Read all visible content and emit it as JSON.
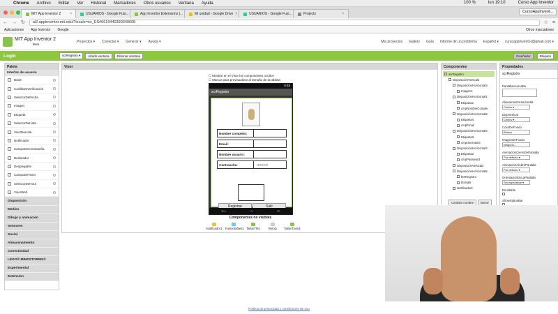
{
  "mac": {
    "apple": "",
    "app": "Chrome",
    "menus": [
      "Archivo",
      "Editar",
      "Ver",
      "Historial",
      "Marcadores",
      "Otros usuarios",
      "Ventana",
      "Ayuda"
    ],
    "battery": "100 %",
    "time": "lun 19:10",
    "user": "Curso App Inventor"
  },
  "tabs": [
    {
      "label": "MIT App Inventor 2"
    },
    {
      "label": "USUARIOS - Google Fusi..."
    },
    {
      "label": "App Inventor Extensions |..."
    },
    {
      "label": "Mi unidad - Google Drive"
    },
    {
      "label": "USUARIOS - Google Fusi..."
    },
    {
      "label": "Projects"
    }
  ],
  "profile": "CursoAppInvent...",
  "url": "ai2.appinventor.mit.edu/?locale=es_ES#6619440390340608",
  "bookmarks": [
    "Aplicaciones",
    "App Inventor",
    "Google"
  ],
  "other_bookmarks": "Otros marcadores",
  "ai": {
    "title": "MIT App Inventor 2",
    "beta": "Beta",
    "menus": [
      "Proyectos ▾",
      "Conectar ▾",
      "Generar ▾",
      "Ayuda ▾"
    ],
    "right": [
      "Mis proyectos",
      "Gallery",
      "Guía",
      "Informe de un problema",
      "Español ▾",
      "cursoappinventor@gmail.com ▾"
    ]
  },
  "toolbar": {
    "project": "Login",
    "screen": "scrRegistro ▾",
    "add": "Añadir ventana",
    "remove": "Eliminar ventana",
    "designer": "Diseñador",
    "blocks": "Bloques"
  },
  "palette": {
    "title": "Paleta",
    "section": "Interfaz de usuario",
    "items": [
      "Botón",
      "CasillaDeVerificación",
      "SelectorDeFecha",
      "Imagen",
      "Etiqueta",
      "SelectorDeLista",
      "VisorDeLista",
      "Notificador",
      "CampoDeContraseña",
      "Deslizador",
      "Desplegable",
      "CampoDeTexto",
      "SelectorDeHora",
      "VisorWeb"
    ],
    "categories": [
      "Disposición",
      "Medios",
      "Dibujo y animación",
      "Sensores",
      "Social",
      "Almacenamiento",
      "Conectividad",
      "LEGO® MINDSTORMS®",
      "Experimental",
      "Extension"
    ]
  },
  "viewer": {
    "title": "Visor",
    "check1": "Mostrar en el Visor los componentes ocultos",
    "check2": "Marcar para previsualizar al tamaño de la tableta",
    "time": "9:48",
    "screen": "scrRegistro",
    "fields": [
      {
        "label": "Nombre completo:",
        "value": ""
      },
      {
        "label": "Email:",
        "value": ""
      },
      {
        "label": "Nombre usuario:",
        "value": ""
      },
      {
        "label": "Contraseña:",
        "value": "••••••••••"
      }
    ],
    "btn1": "Registrar",
    "btn2": "Salir",
    "nonvisible": "Componentes no visibles",
    "nv_items": [
      "Notificador1",
      "Fusiontables1",
      "TaifunTM1",
      "Reloj1",
      "TaifunTools1"
    ]
  },
  "components": {
    "title": "Componentes",
    "tree": [
      "scrRegistro",
      "DisposiciónVertical1",
      "DisposiciónHorizontal3",
      "Imagen1",
      "DisposiciónHorizontal1",
      "Etiqueta1",
      "cmpNombreComple",
      "DisposiciónHorizontal6",
      "Etiqueta4",
      "cmpEmail",
      "DisposiciónHorizontal4",
      "Etiqueta3",
      "cmpUsername",
      "DisposiciónHorizontal2",
      "Etiqueta2",
      "cmpPassword",
      "DisposiciónVertical2",
      "DisposiciónHorizontal5",
      "btnRegistro",
      "btnSalir",
      "Notificador1"
    ],
    "rename": "Cambiar nombre",
    "delete": "Borrar"
  },
  "properties": {
    "title": "Propiedades",
    "component": "scrRegistro",
    "list": [
      {
        "label": "PantallaAcercaDe",
        "value": ""
      },
      {
        "label": "AlineamientoHorizontal",
        "value": "Centro ▾"
      },
      {
        "label": "DispVertical",
        "value": "Centro ▾"
      },
      {
        "label": "ColorDeFondo",
        "value": "Blanco"
      },
      {
        "label": "ImagenDeFondo",
        "value": "Ninguno..."
      },
      {
        "label": "AnimaciónCierreDePantalla",
        "value": "Por defecto ▾"
      },
      {
        "label": "AnimaciónAlAbrirPantalla",
        "value": "Por defecto ▾"
      },
      {
        "label": "OrientaciónDeLaPantalla",
        "value": "Sin especificar ▾"
      },
      {
        "label": "Enrollable",
        "value": ""
      },
      {
        "label": "ShowStatusBar",
        "value": ""
      }
    ]
  },
  "footer": "Política de privacidad y condiciones de uso"
}
